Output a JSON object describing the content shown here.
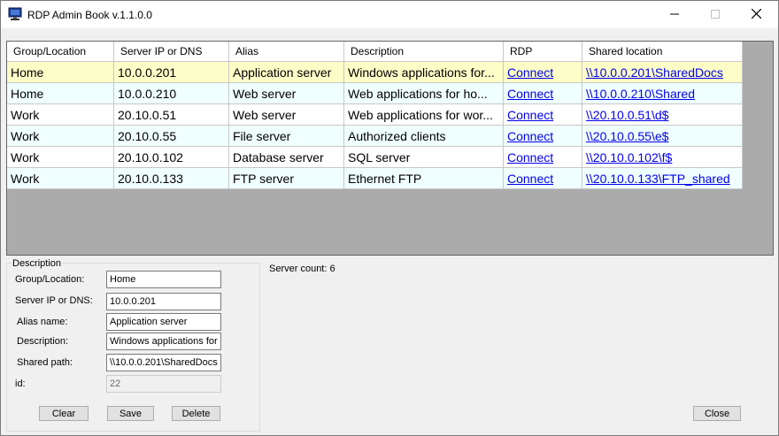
{
  "window": {
    "title": "RDP Admin Book v.1.1.0.0"
  },
  "grid": {
    "headers": [
      "Group/Location",
      "Server IP or DNS",
      "Alias",
      "Description",
      "RDP",
      "Shared location"
    ],
    "rows": [
      {
        "group": "Home",
        "ip": "10.0.0.201",
        "alias": "Application server",
        "description": "Windows applications for...",
        "rdp": "Connect",
        "shared": "\\\\10.0.0.201\\SharedDocs"
      },
      {
        "group": "Home",
        "ip": "10.0.0.210",
        "alias": "Web server",
        "description": "Web applications for ho...",
        "rdp": "Connect",
        "shared": "\\\\10.0.0.210\\Shared"
      },
      {
        "group": "Work",
        "ip": "20.10.0.51",
        "alias": "Web server",
        "description": "Web applications for wor...",
        "rdp": "Connect",
        "shared": "\\\\20.10.0.51\\d$"
      },
      {
        "group": "Work",
        "ip": "20.10.0.55",
        "alias": "File server",
        "description": "Authorized clients",
        "rdp": "Connect",
        "shared": "\\\\20.10.0.55\\e$"
      },
      {
        "group": "Work",
        "ip": "20.10.0.102",
        "alias": "Database server",
        "description": "SQL server",
        "rdp": "Connect",
        "shared": "\\\\20.10.0.102\\f$"
      },
      {
        "group": "Work",
        "ip": "20.10.0.133",
        "alias": "FTP server",
        "description": "Ethernet FTP",
        "rdp": "Connect",
        "shared": "\\\\20.10.0.133\\FTP_shared"
      }
    ]
  },
  "details": {
    "legend": "Description",
    "group_label": "Group/Location:",
    "group_value": "Home",
    "ip_label": "Server IP or DNS:",
    "ip_value": "10.0.0.201",
    "alias_label": "Alias name:",
    "alias_value": "Application server",
    "description_label": "Description:",
    "description_value": "Windows applications for h",
    "shared_label": "Shared path:",
    "shared_value": "\\\\10.0.0.201\\SharedDocs",
    "id_label": "id:",
    "id_value": "22"
  },
  "buttons": {
    "clear": "Clear",
    "save": "Save",
    "delete": "Delete",
    "close": "Close"
  },
  "status": {
    "server_count": "Server count: 6"
  },
  "colors": {
    "selected_row": "#fdfdc8",
    "alt_row": "#f0ffff",
    "link": "#0000ee"
  }
}
